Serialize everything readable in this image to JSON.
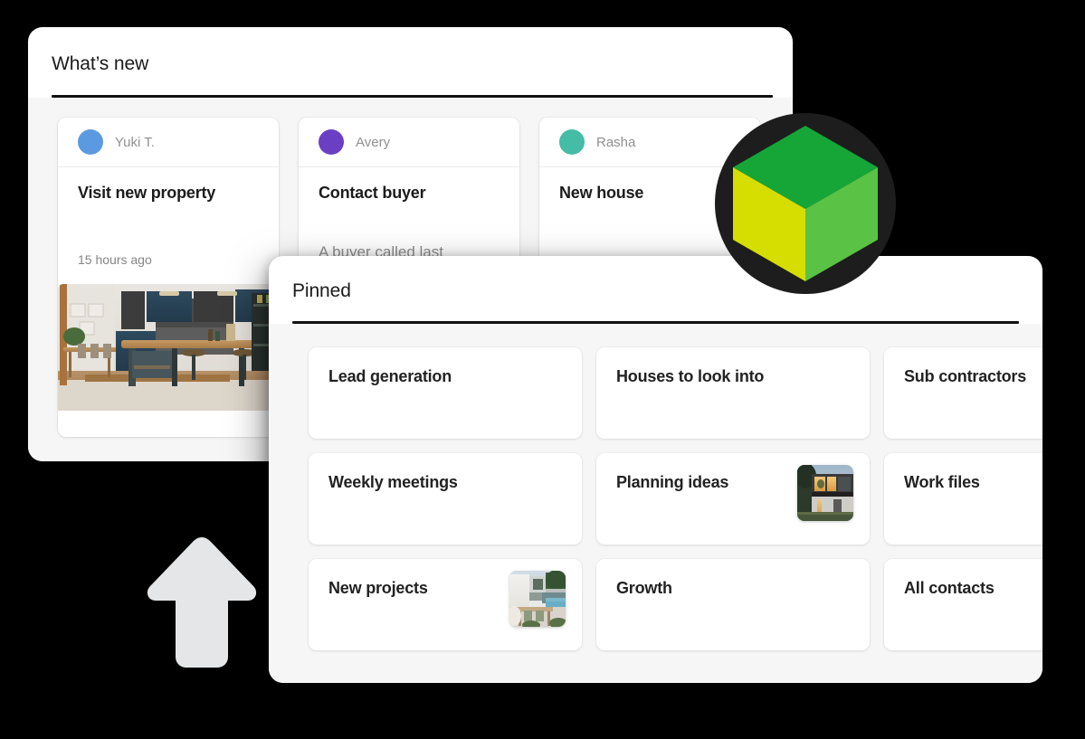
{
  "theme": {
    "backdrop": "#000000",
    "panel_bg": "#ffffff",
    "panel_body_bg": "#f6f6f6",
    "rule_color": "#111111",
    "title_color": "#1b1b1b",
    "muted_text": "#8e8e8e",
    "arrow_color": "#e4e6e7",
    "logo_circle": "#1d1d1d",
    "logo_top_face": "#16a637",
    "logo_left_face": "#d6dd00",
    "logo_right_face": "#5ac245"
  },
  "whats_new": {
    "title": "What’s new",
    "cards": [
      {
        "author": "Yuki T.",
        "avatar_color": "#5b9ae0",
        "title": "Visit new property",
        "snippet": "",
        "time": "15 hours ago",
        "has_photo": true,
        "photo_name": "kitchen-interior-photo"
      },
      {
        "author": "Avery",
        "avatar_color": "#6b3fc4",
        "title": "Contact buyer",
        "snippet": "A buyer called last",
        "time": "",
        "has_photo": false,
        "photo_name": ""
      },
      {
        "author": "Rasha",
        "avatar_color": "#45bca5",
        "title": "New house",
        "snippet": "",
        "time": "",
        "has_photo": false,
        "photo_name": ""
      }
    ]
  },
  "pinned": {
    "title": "Pinned",
    "items": [
      {
        "label": "Lead generation",
        "thumb": ""
      },
      {
        "label": "Houses to look into",
        "thumb": ""
      },
      {
        "label": "Sub contractors",
        "thumb": ""
      },
      {
        "label": "Weekly meetings",
        "thumb": ""
      },
      {
        "label": "Planning ideas",
        "thumb": "modern-house-dusk-photo"
      },
      {
        "label": "Work files",
        "thumb": ""
      },
      {
        "label": "New projects",
        "thumb": "patio-pool-photo"
      },
      {
        "label": "Growth",
        "thumb": ""
      },
      {
        "label": "All contacts",
        "thumb": ""
      }
    ]
  },
  "logo": {
    "name": "green-cube-logo"
  },
  "arrow": {
    "name": "up-arrow-indicator"
  }
}
